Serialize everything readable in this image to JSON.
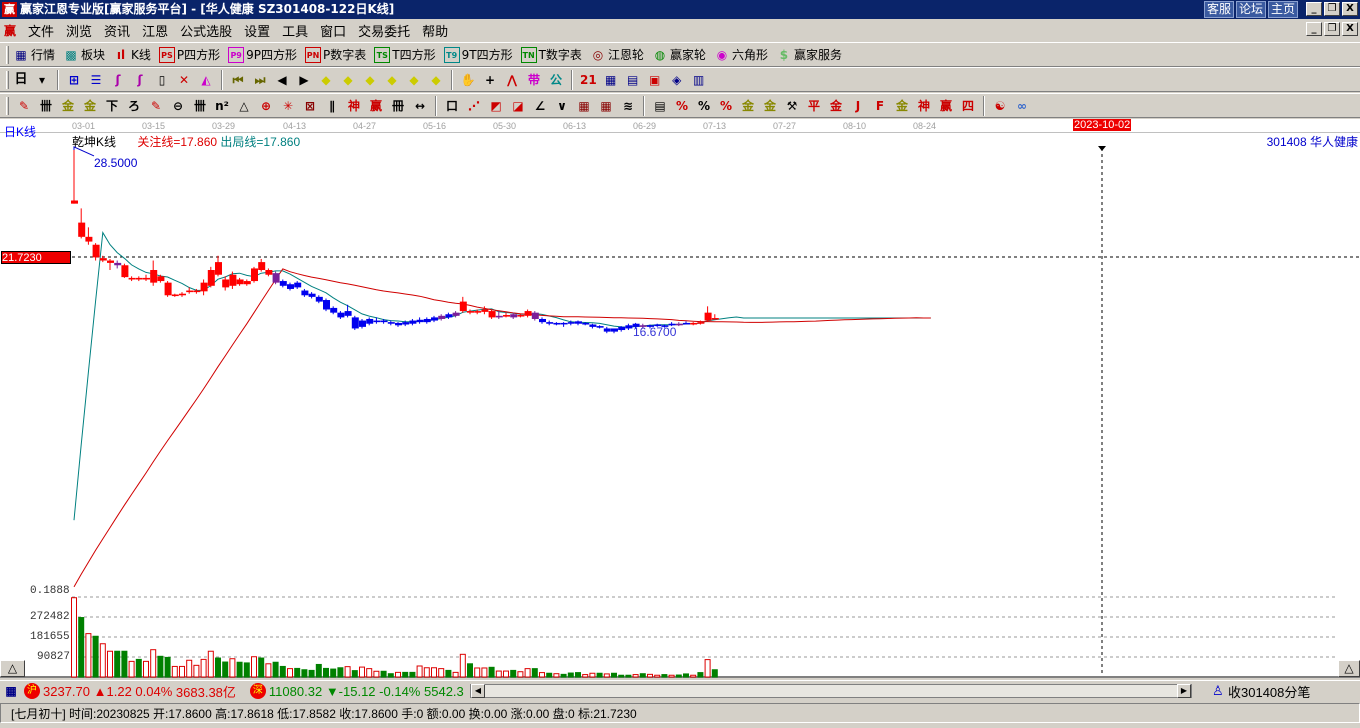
{
  "window": {
    "title": "赢家江恩专业版[赢家服务平台] - [华人健康   SZ301408-122日K线]",
    "logo": "赢",
    "links": [
      "客服",
      "论坛",
      "主页"
    ],
    "buttons": [
      "_",
      "❐",
      "X"
    ]
  },
  "menu": {
    "logo": "赢",
    "items": [
      "文件",
      "浏览",
      "资讯",
      "江恩",
      "公式选股",
      "设置",
      "工具",
      "窗口",
      "交易委托",
      "帮助"
    ]
  },
  "toolbar1": [
    {
      "icon": "market-table-icon",
      "glyph": "▦",
      "color": "#000080",
      "label": "行情"
    },
    {
      "icon": "sector-icon",
      "glyph": "▩",
      "color": "#008080",
      "label": "板块"
    },
    {
      "icon": "kline-icon",
      "glyph": "ıl",
      "color": "#c00",
      "label": "K线"
    },
    {
      "icon": "ps-icon",
      "glyph": "PS",
      "color": "#c00",
      "label": "P四方形"
    },
    {
      "icon": "p9-icon",
      "glyph": "P9",
      "color": "#c0c",
      "label": "9P四方形"
    },
    {
      "icon": "pn-icon",
      "glyph": "PN",
      "color": "#c00",
      "label": "P数字表"
    },
    {
      "icon": "ts-icon",
      "glyph": "TS",
      "color": "#080",
      "label": "T四方形"
    },
    {
      "icon": "t9-icon",
      "glyph": "T9",
      "color": "#088",
      "label": "9T四方形"
    },
    {
      "icon": "tn-icon",
      "glyph": "TN",
      "color": "#080",
      "label": "T数字表"
    },
    {
      "icon": "gann-wheel-icon",
      "glyph": "◎",
      "color": "#800",
      "label": "江恩轮"
    },
    {
      "icon": "winner-wheel-icon",
      "glyph": "◍",
      "color": "#080",
      "label": "赢家轮"
    },
    {
      "icon": "hexagon-icon",
      "glyph": "◉",
      "color": "#c0c",
      "label": "六角形"
    },
    {
      "icon": "dollar-icon",
      "glyph": "$",
      "color": "#6b6",
      "label": "赢家服务"
    }
  ],
  "toolbar2": {
    "period": "日",
    "icons": [
      [
        "period-dropdown-icon",
        "▾",
        "#000"
      ],
      [
        "sep"
      ],
      [
        "chart-grid-icon",
        "⊞",
        "#00c"
      ],
      [
        "notes-icon",
        "☰",
        "#00c"
      ],
      [
        "wave3-icon",
        "ʃ",
        "#a0a"
      ],
      [
        "wave9-icon",
        "ʃ",
        "#a0a"
      ],
      [
        "candle-dropdown-icon",
        "▯",
        "#000"
      ],
      [
        "indicator-icon",
        "✕",
        "#c00"
      ],
      [
        "flag-icon",
        "◭",
        "#c0c"
      ],
      [
        "sep"
      ],
      [
        "first-icon",
        "⏮",
        "#660"
      ],
      [
        "last-icon",
        "⏭",
        "#660"
      ],
      [
        "left-icon",
        "◀",
        "#000"
      ],
      [
        "right-icon",
        "▶",
        "#000"
      ],
      [
        "diamond-left-icon",
        "◆",
        "#cc0"
      ],
      [
        "diamond-right-icon",
        "◆",
        "#cc0"
      ],
      [
        "diamond-lr-icon",
        "◆",
        "#cc0"
      ],
      [
        "diamond-x-icon",
        "◆",
        "#cc0"
      ],
      [
        "diamond-star-icon",
        "◆",
        "#cc0"
      ],
      [
        "diamond-cross-icon",
        "◆",
        "#cc0"
      ],
      [
        "sep"
      ],
      [
        "hand-icon",
        "✋",
        "#000"
      ],
      [
        "crosshair-icon",
        "+",
        "#000"
      ],
      [
        "zigzag-icon",
        "⋀",
        "#c00"
      ],
      [
        "pattern-icon",
        "带",
        "#c0c"
      ],
      [
        "formula-icon",
        "公",
        "#088"
      ],
      [
        "sep"
      ],
      [
        "calendar-icon",
        "21",
        "#c00"
      ],
      [
        "calculator-icon",
        "▦",
        "#008"
      ],
      [
        "document-icon",
        "▤",
        "#008"
      ],
      [
        "save-icon",
        "▣",
        "#c00"
      ],
      [
        "network-icon",
        "◈",
        "#008"
      ],
      [
        "printer-icon",
        "▥",
        "#008"
      ]
    ]
  },
  "toolbar3": {
    "icons": [
      [
        "pen-icon",
        "✎",
        "#c00"
      ],
      [
        "grid-icon",
        "卌",
        "#000"
      ],
      [
        "gold1-icon",
        "金",
        "#880"
      ],
      [
        "gold2-icon",
        "金",
        "#880"
      ],
      [
        "f-icon",
        "下",
        "#000"
      ],
      [
        "spiral-icon",
        "ろ",
        "#000"
      ],
      [
        "pen2-icon",
        "✎",
        "#c00"
      ],
      [
        "circle-icon",
        "⊖",
        "#000"
      ],
      [
        "bars-icon",
        "卌",
        "#000"
      ],
      [
        "n2-icon",
        "n²",
        "#000"
      ],
      [
        "triangle-icon",
        "△",
        "#000"
      ],
      [
        "target-icon",
        "⊕",
        "#c00"
      ],
      [
        "star-icon",
        "✳",
        "#c00"
      ],
      [
        "square-icon",
        "⊠",
        "#800"
      ],
      [
        "lines-icon",
        "∥",
        "#000"
      ],
      [
        "shen-icon",
        "神",
        "#c00"
      ],
      [
        "ying-icon",
        "赢",
        "#c00"
      ],
      [
        "ruler-icon",
        "冊",
        "#000"
      ],
      [
        "arrows-icon",
        "↔",
        "#000"
      ],
      [
        "sep"
      ],
      [
        "box-icon",
        "口",
        "#000"
      ],
      [
        "fan-icon",
        "⋰",
        "#c00"
      ],
      [
        "fan-box-icon",
        "◩",
        "#c00"
      ],
      [
        "fan-box2-icon",
        "◪",
        "#c00"
      ],
      [
        "angle-icon",
        "∠",
        "#000"
      ],
      [
        "v-icon",
        "∨",
        "#000"
      ],
      [
        "grid2-icon",
        "▦",
        "#800"
      ],
      [
        "grid3-icon",
        "▦",
        "#800"
      ],
      [
        "parallel-icon",
        "≋",
        "#000"
      ],
      [
        "sep"
      ],
      [
        "table-icon",
        "▤",
        "#000"
      ],
      [
        "percent-red-icon",
        "%",
        "#c00"
      ],
      [
        "percent-icon",
        "%",
        "#000"
      ],
      [
        "percent-lines-icon",
        "%",
        "#c00"
      ],
      [
        "gold-circle-icon",
        "金",
        "#880"
      ],
      [
        "gold-lines-icon",
        "金",
        "#880"
      ],
      [
        "tool-icon",
        "⚒",
        "#000"
      ],
      [
        "ping-icon",
        "平",
        "#c00"
      ],
      [
        "gold3-icon",
        "金",
        "#c00"
      ],
      [
        "j-icon",
        "J",
        "#c00"
      ],
      [
        "f2-icon",
        "F",
        "#c00"
      ],
      [
        "gold4-icon",
        "金",
        "#880"
      ],
      [
        "shen2-icon",
        "神",
        "#c00"
      ],
      [
        "ying2-icon",
        "赢",
        "#c00"
      ],
      [
        "four-icon",
        "四",
        "#c00"
      ],
      [
        "sep"
      ],
      [
        "yinyang-icon",
        "☯",
        "#c00"
      ],
      [
        "infinity-icon",
        "∞",
        "#36c"
      ]
    ]
  },
  "chart": {
    "period_label": "日K线",
    "indicator_name": "乾坤K线",
    "focus_line": "关注线=17.860",
    "exit_line": "出局线=17.860",
    "high_label": "28.5000",
    "low_label": "16.6700",
    "price_marker": "21.7230",
    "date_marker": "2023-10-02",
    "stock": "301408  华人健康",
    "date_ticks": [
      "03-01",
      "03-15",
      "03-29",
      "04-13",
      "04-27",
      "05-16",
      "05-30",
      "06-13",
      "06-29",
      "07-13",
      "07-27",
      "08-10",
      "08-24"
    ],
    "vol_labels": [
      "0.1888",
      "272482",
      "181655",
      "90827"
    ]
  },
  "chart_data": {
    "type": "candlestick",
    "marker_price": 21.723,
    "ma_periods": [
      5,
      30
    ],
    "ma_colors": [
      "#008080",
      "#d00000"
    ],
    "ohlc": [
      [
        25.1,
        25.3,
        28.5,
        25.1
      ],
      [
        23.0,
        23.9,
        24.8,
        22.9
      ],
      [
        22.7,
        23.0,
        23.6,
        22.5
      ],
      [
        21.7,
        22.5,
        22.6,
        21.5
      ],
      [
        21.5,
        21.65,
        21.8,
        21.4
      ],
      [
        21.35,
        21.5,
        21.6,
        20.9
      ],
      [
        21.2,
        21.35,
        21.5,
        21.0
      ],
      [
        20.45,
        21.2,
        21.3,
        20.4
      ],
      [
        20.3,
        20.4,
        20.5,
        20.2
      ],
      [
        20.3,
        20.4,
        20.5,
        20.2
      ],
      [
        20.3,
        20.4,
        20.6,
        20.2
      ],
      [
        20.1,
        20.9,
        21.5,
        19.9
      ],
      [
        20.2,
        20.5,
        20.6,
        20.1
      ],
      [
        19.3,
        20.1,
        20.2,
        19.2
      ],
      [
        19.25,
        19.35,
        19.4,
        19.2
      ],
      [
        19.3,
        19.4,
        19.5,
        19.2
      ],
      [
        19.5,
        19.6,
        19.8,
        19.4
      ],
      [
        19.5,
        19.6,
        19.7,
        19.4
      ],
      [
        19.55,
        20.1,
        20.3,
        19.3
      ],
      [
        19.9,
        20.9,
        21.1,
        19.8
      ],
      [
        20.6,
        21.4,
        21.8,
        20.5
      ],
      [
        19.8,
        20.3,
        20.5,
        19.6
      ],
      [
        19.9,
        20.6,
        20.8,
        19.7
      ],
      [
        20.0,
        20.3,
        20.4,
        19.9
      ],
      [
        20.0,
        20.2,
        20.3,
        19.9
      ],
      [
        20.2,
        21.0,
        21.1,
        20.1
      ],
      [
        20.9,
        21.4,
        21.6,
        20.8
      ],
      [
        20.6,
        20.9,
        21.0,
        20.5
      ],
      [
        20.1,
        20.7,
        20.8,
        20.0
      ],
      [
        19.9,
        20.2,
        20.3,
        19.8
      ],
      [
        19.7,
        20.0,
        20.1,
        19.6
      ],
      [
        19.8,
        20.1,
        20.2,
        19.7
      ],
      [
        19.3,
        19.6,
        19.7,
        19.2
      ],
      [
        19.2,
        19.4,
        19.5,
        19.1
      ],
      [
        18.9,
        19.2,
        19.3,
        18.8
      ],
      [
        18.4,
        19.0,
        19.1,
        18.3
      ],
      [
        18.2,
        18.5,
        18.6,
        18.1
      ],
      [
        17.9,
        18.2,
        18.3,
        17.8
      ],
      [
        18.0,
        18.3,
        18.7,
        17.9
      ],
      [
        17.2,
        17.9,
        18.0,
        17.1
      ],
      [
        17.3,
        17.7,
        17.8,
        17.2
      ],
      [
        17.5,
        17.8,
        17.9,
        17.4
      ],
      [
        17.6,
        17.7,
        17.9,
        17.5
      ],
      [
        17.6,
        17.7,
        17.8,
        17.5
      ],
      [
        17.5,
        17.6,
        17.7,
        17.4
      ],
      [
        17.4,
        17.55,
        17.6,
        17.3
      ],
      [
        17.45,
        17.6,
        17.7,
        17.35
      ],
      [
        17.5,
        17.7,
        17.8,
        17.4
      ],
      [
        17.6,
        17.75,
        17.9,
        17.5
      ],
      [
        17.6,
        17.8,
        17.9,
        17.5
      ],
      [
        17.7,
        17.9,
        18.0,
        17.6
      ],
      [
        17.8,
        18.0,
        18.1,
        17.7
      ],
      [
        17.9,
        18.1,
        18.2,
        17.8
      ],
      [
        18.0,
        18.2,
        18.3,
        17.9
      ],
      [
        18.3,
        18.9,
        19.2,
        18.2
      ],
      [
        18.2,
        18.3,
        18.4,
        18.1
      ],
      [
        18.2,
        18.3,
        18.4,
        18.1
      ],
      [
        18.25,
        18.4,
        18.6,
        18.1
      ],
      [
        17.9,
        18.3,
        18.4,
        17.8
      ],
      [
        17.9,
        18.0,
        18.3,
        17.8
      ],
      [
        17.95,
        18.05,
        18.2,
        17.9
      ],
      [
        17.9,
        18.1,
        18.2,
        17.8
      ],
      [
        18.0,
        18.05,
        18.1,
        17.9
      ],
      [
        18.0,
        18.3,
        18.4,
        17.9
      ],
      [
        17.8,
        18.2,
        18.3,
        17.7
      ],
      [
        17.6,
        17.8,
        17.9,
        17.5
      ],
      [
        17.5,
        17.6,
        17.7,
        17.4
      ],
      [
        17.45,
        17.55,
        17.6,
        17.4
      ],
      [
        17.5,
        17.55,
        17.6,
        17.3
      ],
      [
        17.5,
        17.6,
        17.7,
        17.4
      ],
      [
        17.5,
        17.65,
        17.7,
        17.4
      ],
      [
        17.45,
        17.55,
        17.6,
        17.4
      ],
      [
        17.3,
        17.45,
        17.5,
        17.2
      ],
      [
        17.25,
        17.35,
        17.4,
        17.2
      ],
      [
        17.0,
        17.2,
        17.3,
        16.9
      ],
      [
        17.0,
        17.2,
        17.2,
        16.9
      ],
      [
        17.1,
        17.3,
        17.35,
        17.0
      ],
      [
        17.2,
        17.4,
        17.5,
        17.1
      ],
      [
        17.3,
        17.5,
        17.55,
        17.2
      ],
      [
        17.3,
        17.4,
        17.5,
        17.2
      ],
      [
        17.3,
        17.4,
        17.45,
        17.2
      ],
      [
        17.35,
        17.45,
        17.5,
        17.3
      ],
      [
        17.3,
        17.4,
        17.45,
        17.25
      ],
      [
        17.4,
        17.5,
        17.6,
        17.35
      ],
      [
        17.4,
        17.5,
        17.6,
        17.35
      ],
      [
        17.5,
        17.55,
        17.65,
        17.45
      ],
      [
        17.45,
        17.55,
        17.6,
        17.4
      ],
      [
        17.5,
        17.6,
        17.7,
        17.45
      ],
      [
        17.7,
        18.2,
        18.6,
        17.65
      ],
      [
        17.86,
        17.86,
        18.1,
        17.86
      ]
    ],
    "candle_colors": "rrrrrrprrrrrrrrrrrrrrrrrrrrrpbbbbbbbbbbbbbbbbbbbbbbpbprrrrrprprrpbbbbbbbbbbbbbbpbbbbpbrrrr",
    "volume": [
      360000,
      270000,
      197000,
      185000,
      151000,
      117000,
      117000,
      117000,
      71000,
      80000,
      71000,
      124000,
      94000,
      89000,
      48000,
      48000,
      76000,
      53000,
      80000,
      117000,
      86000,
      68000,
      83000,
      67000,
      64000,
      92000,
      86000,
      60000,
      67000,
      48000,
      38000,
      39000,
      33000,
      30000,
      57000,
      39000,
      36000,
      42000,
      47000,
      29000,
      45000,
      38000,
      26000,
      26000,
      15000,
      21000,
      21000,
      21000,
      50000,
      42000,
      42000,
      38000,
      30000,
      21000,
      103000,
      60000,
      41000,
      41000,
      44000,
      27000,
      27000,
      30000,
      24000,
      38000,
      38000,
      20000,
      17000,
      15000,
      12000,
      18000,
      20000,
      11000,
      17000,
      17000,
      14000,
      17000,
      8000,
      8000,
      11000,
      15000,
      12000,
      8000,
      11000,
      8000,
      9000,
      14000,
      8000,
      20000,
      79000,
      33000
    ],
    "volume_colors": "rgrgrrggrgrrggrrrrrrggrggrgrggrgggggggrgrrrggrggrrrrgrrgrrgrrgrrgrgrgggrrgrgggrgrrgrggrgrgr",
    "extend_bars": 30,
    "price_per_px": 0.0633
  },
  "status": {
    "sh_badge": "沪",
    "sh_index": "3237.70",
    "sh_change": "▲1.22",
    "sh_pct": "0.04%",
    "sh_amount": "3683.38亿",
    "sz_badge": "深",
    "sz_index": "11080.32",
    "sz_change": "▼-15.12",
    "sz_pct": "-0.14%",
    "sz_amount": "5542.3",
    "receive": "收301408分笔"
  },
  "info": "[七月初十] 时间:20230825 开:17.8600 高:17.8618 低:17.8582 收:17.8600 手:0 额:0.00 换:0.00 涨:0.00 盘:0 标:21.7230"
}
